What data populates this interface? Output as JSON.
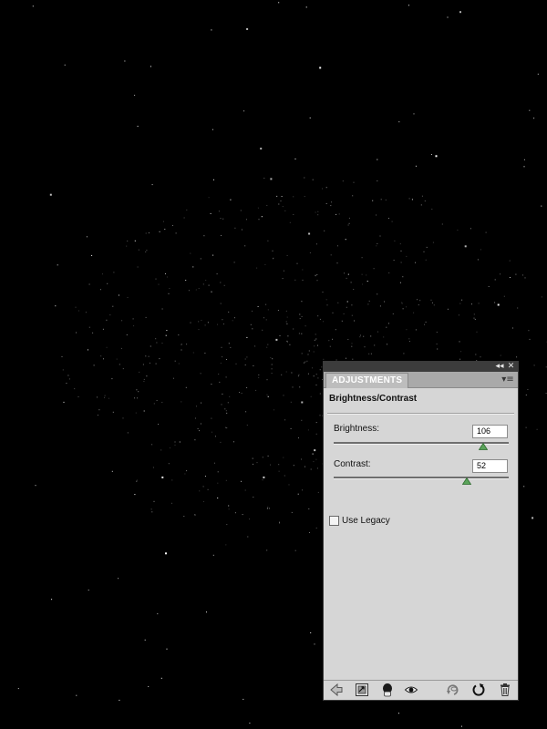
{
  "panel": {
    "collapse_glyph": "◂◂",
    "close_glyph": "✕",
    "tab_label": "ADJUSTMENTS",
    "menu_glyph": "▾≡",
    "adjustment_title": "Brightness/Contrast"
  },
  "brightness": {
    "label": "Brightness:",
    "value": "106",
    "slider_fraction": 0.855
  },
  "contrast": {
    "label": "Contrast:",
    "value": "52",
    "slider_fraction": 0.76
  },
  "legacy": {
    "label": "Use Legacy",
    "checked": false
  },
  "icons": {
    "back": "arrow-left-icon",
    "clip": "clip-to-layer-icon",
    "visibility": "visibility-toggle-icon",
    "eye": "eye-icon",
    "view_previous": "view-previous-state-icon",
    "reset": "reset-icon",
    "trash": "trash-icon"
  },
  "colors": {
    "panel_bg": "#d6d6d6",
    "tab_row": "#a9a9a9",
    "topbar": "#3c3c3c",
    "slider_thumb": "#5aa35a"
  }
}
